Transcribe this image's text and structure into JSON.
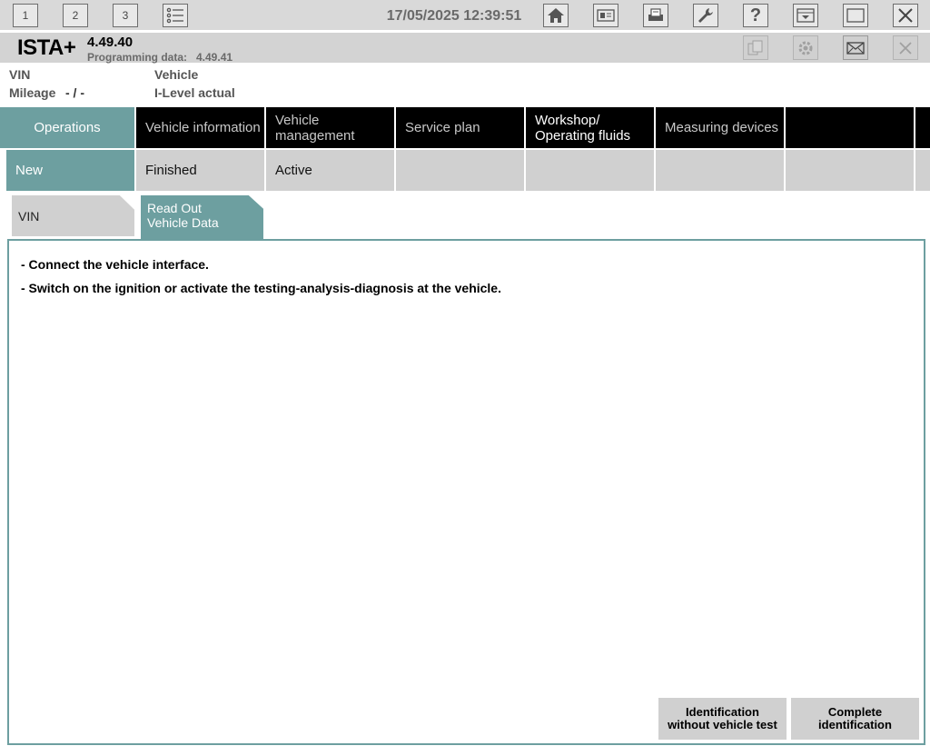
{
  "toolbar": {
    "window_buttons": [
      "1",
      "2",
      "3"
    ],
    "datetime": "17/05/2025 12:39:51"
  },
  "app": {
    "name": "ISTA+",
    "version": "4.49.40",
    "programming_label": "Programming data:",
    "programming_value": "4.49.41"
  },
  "vehicle_info": {
    "vin_label": "VIN",
    "mileage_label": "Mileage",
    "mileage_value": "- / -",
    "vehicle_label": "Vehicle",
    "ilevel_label": "I-Level actual"
  },
  "main_tabs": [
    {
      "label": "Operations"
    },
    {
      "label": "Vehicle information"
    },
    {
      "label": "Vehicle management"
    },
    {
      "label": "Service plan"
    },
    {
      "label": "Workshop/ Operating fluids"
    },
    {
      "label": "Measuring devices"
    }
  ],
  "sub_tabs": [
    {
      "label": "New"
    },
    {
      "label": "Finished"
    },
    {
      "label": "Active"
    }
  ],
  "step_tabs": [
    {
      "label": "VIN"
    },
    {
      "label": "Read Out Vehicle Data"
    }
  ],
  "content": {
    "messages": [
      "- Connect the vehicle interface.",
      "- Switch on the ignition or activate the testing-analysis-diagnosis at the vehicle."
    ],
    "buttons": [
      {
        "label": "Identification without vehicle test"
      },
      {
        "label": "Complete identification"
      }
    ]
  },
  "colors": {
    "accent": "#6d9fa0",
    "tab_bar": "#000000",
    "toolbar": "#d9d9d9",
    "subtab": "#d0d0d0"
  }
}
